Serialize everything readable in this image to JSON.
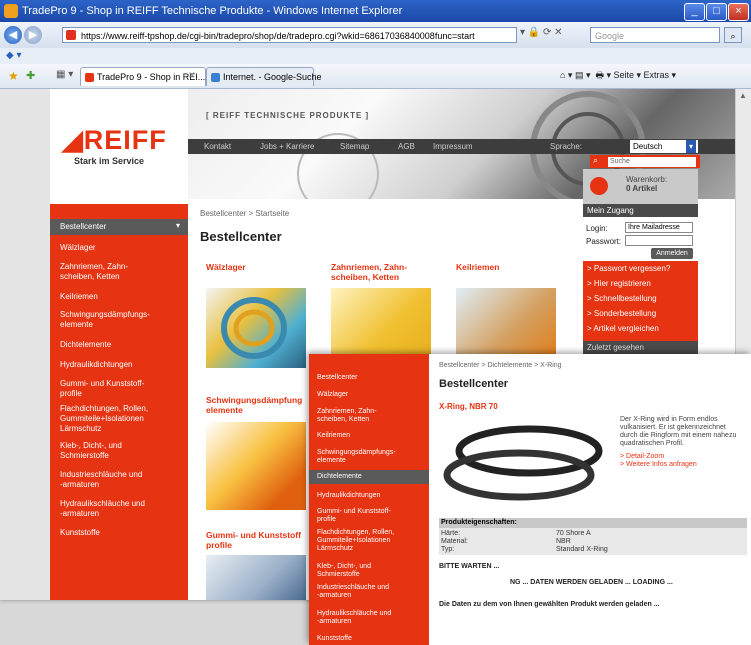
{
  "browser": {
    "title": "TradePro 9 - Shop in REIFF Technische Produkte - Windows Internet Explorer",
    "url": "https://www.reiff-tpshop.de/cgi-bin/tradepro/shop/de/tradepro.cgi?wkid=68617036840008func=start",
    "search_placeholder": "Google",
    "tabs": [
      {
        "label": "TradePro 9 - Shop in REI..."
      },
      {
        "label": "Internet. - Google-Suche"
      }
    ],
    "toolbar_right": "Seite ▾  Extras ▾",
    "colors": {
      "titlebar": "#2d64c8",
      "brand_red": "#e63312"
    }
  },
  "site": {
    "logo_text": "REIFF",
    "logo_sub": "Stark im Service",
    "header_title": "[ REIFF TECHNISCHE PRODUKTE ]",
    "topnav": [
      "Kontakt",
      "Jobs + Karriere",
      "Sitemap",
      "AGB",
      "Impressum"
    ],
    "sprache_label": "Sprache:",
    "language": "Deutsch",
    "search_placeholder": "Suche",
    "cart_label": "Warenkorb:",
    "cart_count": "0 Artikel",
    "left_menu_head": "Bestellcenter",
    "left_menu": [
      "Wälzlager",
      "Zahnriemen, Zahn-\nscheiben, Ketten",
      "Keilriemen",
      "Schwingungsdämpfungs-\nelemente",
      "Dichtelemente",
      "Hydraulikdichtungen",
      "Gummi- und Kunststoff-\nprofile",
      "Flachdichtungen, Rollen,\nGummiteile+Isolationen\nLärmschutz",
      "Kleb-, Dicht-, und\nSchmierstoffe",
      "Industrieschläuche und\n-armaturen",
      "Hydraulikschläuche und\n-armaturen",
      "Kunststoffe"
    ],
    "breadcrumb": "Bestellcenter > Startseite",
    "page_title": "Bestellcenter",
    "categories": [
      {
        "title": "Wälzlager"
      },
      {
        "title": "Zahnriemen, Zahn-\nscheiben, Ketten"
      },
      {
        "title": "Keilriemen"
      },
      {
        "title": "Schwingungsdämpfung\nelemente"
      },
      {
        "title": "Gummi- und Kunststoff\nprofile"
      }
    ],
    "zugang": {
      "title": "Mein Zugang",
      "login_label": "Login:",
      "login_value": "Ihre Mailadresse",
      "password_label": "Passwort:",
      "button": "Anmelden",
      "links": [
        "> Passwort vergessen?",
        "> Hier registrieren",
        "> Schnellbestellung",
        "> Sonderbestellung",
        "> Artikel vergleichen"
      ],
      "recently_seen": "Zuletzt gesehen"
    }
  },
  "overlay": {
    "menu": [
      "Bestellcenter",
      "Wälzlager",
      "Zahnriemen, Zahn-\nscheiben, Ketten",
      "Keilriemen",
      "Schwingungsdämpfungs-\nelemente",
      "Dichtelemente",
      "Hydraulikdichtungen",
      "Gummi- und Kunststoff-\nprofile",
      "Flachdichtungen, Rollen,\nGummiteile+Isolationen\nLärmschutz",
      "Kleb-, Dicht-, und\nSchmierstoffe",
      "Industrieschläuche und\n-armaturen",
      "Hydraulikschläuche und\n-armaturen",
      "Kunststoffe"
    ],
    "breadcrumb": "Bestellcenter > Dichtelemente > X-Ring",
    "title": "Bestellcenter",
    "product_name": "X-Ring, NBR 70",
    "description": "Der X-Ring wird in Form endlos vulkanisiert. Er ist gekennzeichnet durch die Ringform mit einem nahezu quadratischen Profil.",
    "links": [
      "> Detail-Zoom",
      "> Weitere Infos anfragen"
    ],
    "props_header": "Produkteigenschaften:",
    "props": [
      {
        "label": "Härte:",
        "value": "70 Shore A"
      },
      {
        "label": "Material:",
        "value": "NBR"
      },
      {
        "label": "Typ:",
        "value": "Standard X-Ring"
      }
    ],
    "wait": "BITTE WARTEN ...",
    "loading": "NG ... DATEN WERDEN GELADEN ... LOADING ...",
    "loading_msg": "Die Daten zu dem von Ihnen gewählten Produkt werden geladen ..."
  }
}
